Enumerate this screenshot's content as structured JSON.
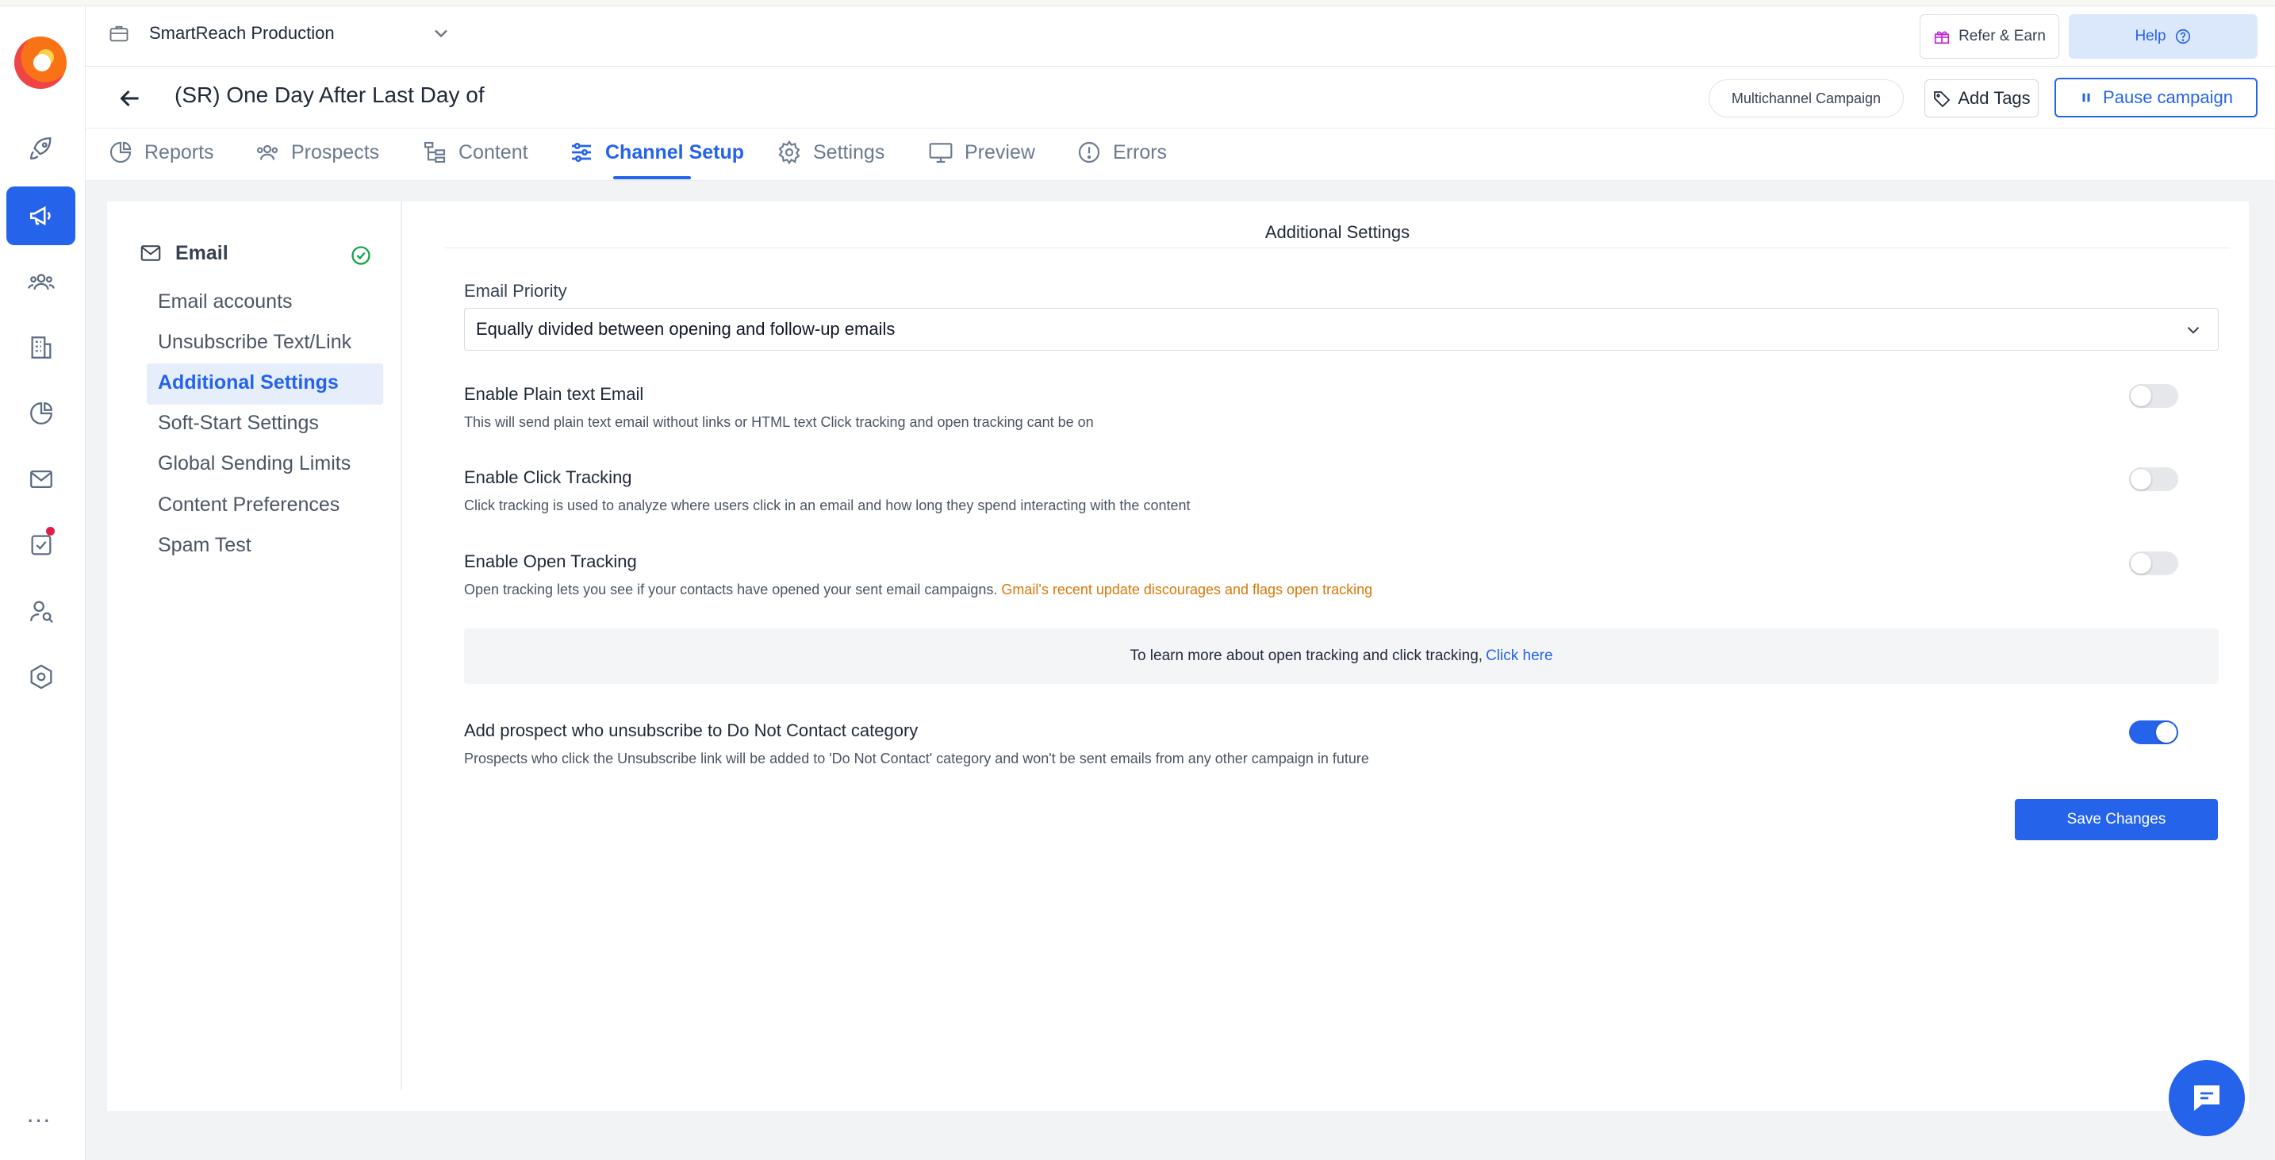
{
  "workspace": {
    "name": "SmartReach Production"
  },
  "topbar": {
    "refer_label": "Refer & Earn",
    "help_label": "Help"
  },
  "header": {
    "title": "(SR) One Day After Last Day of",
    "campaign_type": "Multichannel Campaign",
    "add_tags_label": "Add Tags",
    "pause_label": "Pause campaign"
  },
  "tabs": [
    {
      "label": "Reports",
      "icon": "pie-chart-icon"
    },
    {
      "label": "Prospects",
      "icon": "users-icon"
    },
    {
      "label": "Content",
      "icon": "tree-icon"
    },
    {
      "label": "Channel Setup",
      "icon": "sliders-icon",
      "active": true
    },
    {
      "label": "Settings",
      "icon": "gear-icon"
    },
    {
      "label": "Preview",
      "icon": "monitor-icon"
    },
    {
      "label": "Errors",
      "icon": "alert-circle-icon"
    }
  ],
  "sidenav": {
    "header": "Email",
    "items": [
      "Email accounts",
      "Unsubscribe Text/Link",
      "Additional Settings",
      "Soft-Start Settings",
      "Global Sending Limits",
      "Content Preferences",
      "Spam Test"
    ],
    "active_index": 2
  },
  "section": {
    "title": "Additional Settings",
    "email_priority": {
      "label": "Email Priority",
      "value": "Equally divided between opening and follow-up emails"
    },
    "plain_text": {
      "label": "Enable Plain text Email",
      "desc": "This will send plain text email without links or HTML text Click tracking and open tracking cant be on",
      "enabled": false
    },
    "click_tracking": {
      "label": "Enable Click Tracking",
      "desc": "Click tracking is used to analyze where users click in an email and how long they spend interacting with the content",
      "enabled": false
    },
    "open_tracking": {
      "label": "Enable Open Tracking",
      "desc": "Open tracking lets you see if your contacts have opened your sent email campaigns.",
      "warning": "Gmail's recent update discourages and flags open tracking",
      "enabled": false
    },
    "info": {
      "text": "To learn more about open tracking and click tracking,",
      "link": "Click here"
    },
    "dnc": {
      "label": "Add prospect who unsubscribe to Do Not Contact category",
      "desc": "Prospects who click the Unsubscribe link will be added to 'Do Not Contact' category and won't be sent emails from any other campaign in future",
      "enabled": true
    },
    "save_label": "Save Changes"
  },
  "rail": {
    "more_label": "..."
  },
  "colors": {
    "accent": "#2563eb",
    "warning": "#d97706",
    "success": "#16a34a"
  }
}
